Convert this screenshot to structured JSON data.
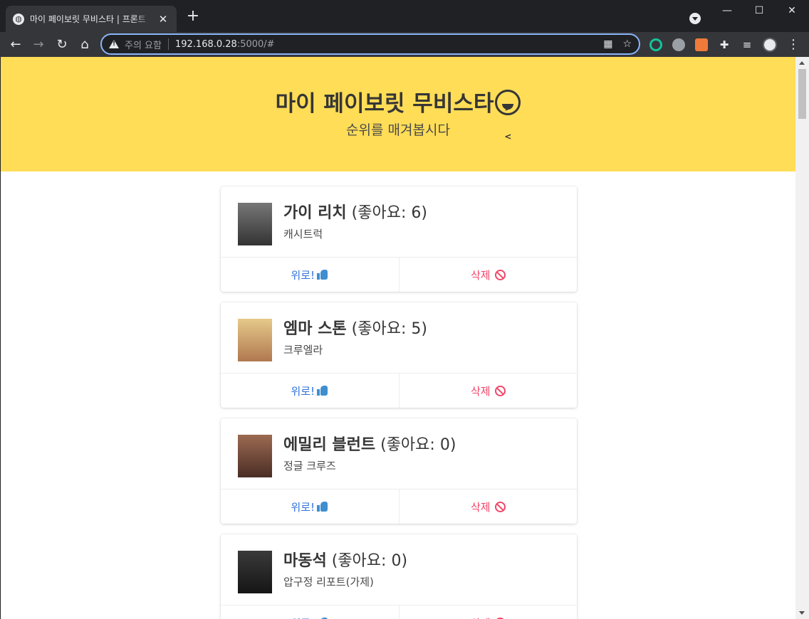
{
  "browser": {
    "tab_title": "마이 페이보릿 무비스타 | 프론트",
    "tab_favicon_icon": "globe-icon",
    "security_warning": "주의 요함",
    "url_host": "192.168.0.28",
    "url_rest": ":5000/#"
  },
  "header": {
    "title": "마이 페이보릿 무비스타",
    "subtitle": "순위를 매겨봅시다"
  },
  "stars": [
    {
      "name": "가이 리치",
      "likes_label": "(좋아요",
      "likes": "6",
      "work": "캐시트럭",
      "photo_color": "#5a5a5a"
    },
    {
      "name": "엠마 스톤",
      "likes_label": "(좋아요",
      "likes": "5",
      "work": "크루엘라",
      "photo_color": "#c9a87a"
    },
    {
      "name": "에밀리 블런트",
      "likes_label": "(좋아요",
      "likes": "0",
      "work": "정글 크루즈",
      "photo_color": "#8a5a44"
    },
    {
      "name": "마동석",
      "likes_label": "(좋아요",
      "likes": "0",
      "work": "압구정 리포트(가제)",
      "photo_color": "#2a2a2a"
    }
  ],
  "actions": {
    "up_label": "위로!",
    "delete_label": "삭제"
  },
  "colors": {
    "hero_bg": "#ffdd57",
    "up": "#3273dc",
    "delete": "#f14668"
  }
}
